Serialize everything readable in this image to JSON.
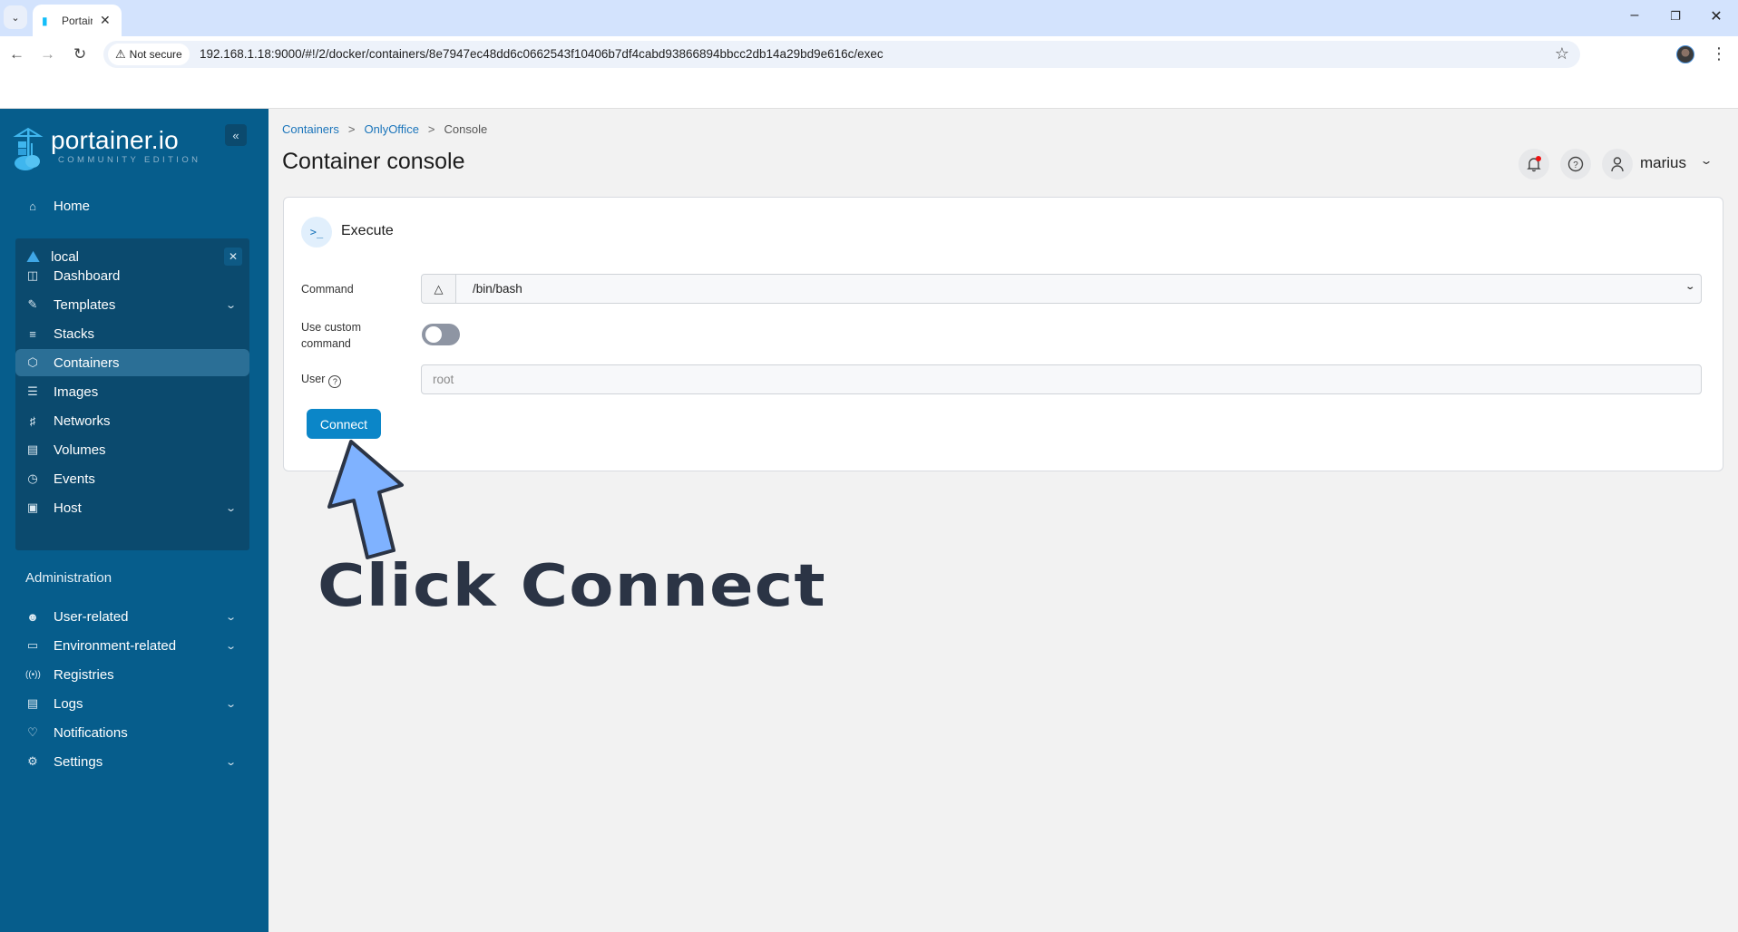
{
  "browser": {
    "tab_title": "Portainer",
    "not_secure_label": "Not secure",
    "url": "192.168.1.18:9000/#!/2/docker/containers/8e7947ec48dd6c0662543f10406b7df4cabd93866894bbcc2db14a29bd9e616c/exec",
    "icons": {
      "tab_list": "chevron-down-icon",
      "close_tab": "close-icon",
      "back": "arrow-left-icon",
      "forward": "arrow-right-icon",
      "reload": "reload-icon",
      "warning": "warning-icon",
      "bookmark": "star-icon",
      "menu": "kebab-icon"
    }
  },
  "sidebar": {
    "logo_name": "portainer.io",
    "logo_edition": "COMMUNITY EDITION",
    "home_label": "Home",
    "environment": {
      "name": "local",
      "items": [
        {
          "label": "Dashboard",
          "icon": "layout-icon",
          "expandable": false
        },
        {
          "label": "Templates",
          "icon": "edit-icon",
          "expandable": true
        },
        {
          "label": "Stacks",
          "icon": "layers-icon",
          "expandable": false
        },
        {
          "label": "Containers",
          "icon": "box-icon",
          "expandable": false,
          "active": true
        },
        {
          "label": "Images",
          "icon": "list-icon",
          "expandable": false
        },
        {
          "label": "Networks",
          "icon": "network-icon",
          "expandable": false
        },
        {
          "label": "Volumes",
          "icon": "database-icon",
          "expandable": false
        },
        {
          "label": "Events",
          "icon": "clock-icon",
          "expandable": false
        },
        {
          "label": "Host",
          "icon": "server-icon",
          "expandable": true
        }
      ]
    },
    "admin_title": "Administration",
    "admin_items": [
      {
        "label": "User-related",
        "icon": "users-icon",
        "expandable": true
      },
      {
        "label": "Environment-related",
        "icon": "hard-drive-icon",
        "expandable": true
      },
      {
        "label": "Registries",
        "icon": "radio-icon",
        "expandable": false
      },
      {
        "label": "Logs",
        "icon": "file-text-icon",
        "expandable": true
      },
      {
        "label": "Notifications",
        "icon": "bell-icon",
        "expandable": false
      },
      {
        "label": "Settings",
        "icon": "gear-icon",
        "expandable": true
      }
    ]
  },
  "header": {
    "breadcrumb": [
      {
        "label": "Containers",
        "link": true
      },
      {
        "label": "OnlyOffice",
        "link": true
      },
      {
        "label": "Console",
        "link": false
      }
    ],
    "breadcrumb_sep": ">",
    "title": "Container console",
    "username": "marius",
    "has_unread_notifications": true
  },
  "card": {
    "title": "Execute",
    "command_label": "Command",
    "command_value": "/bin/bash",
    "custom_command_label": "Use custom command",
    "custom_command_enabled": false,
    "user_label": "User",
    "user_placeholder": "root",
    "connect_label": "Connect"
  },
  "annotation": {
    "text": "Click Connect",
    "arrow_color": "#7fb2ff",
    "text_color": "#2b3445"
  },
  "colors": {
    "sidebar_bg": "#065d8c",
    "env_box_bg": "#0b4a6e",
    "active_item_bg": "#2b6f96",
    "primary_button": "#0b86c8",
    "link": "#1b75bb"
  }
}
